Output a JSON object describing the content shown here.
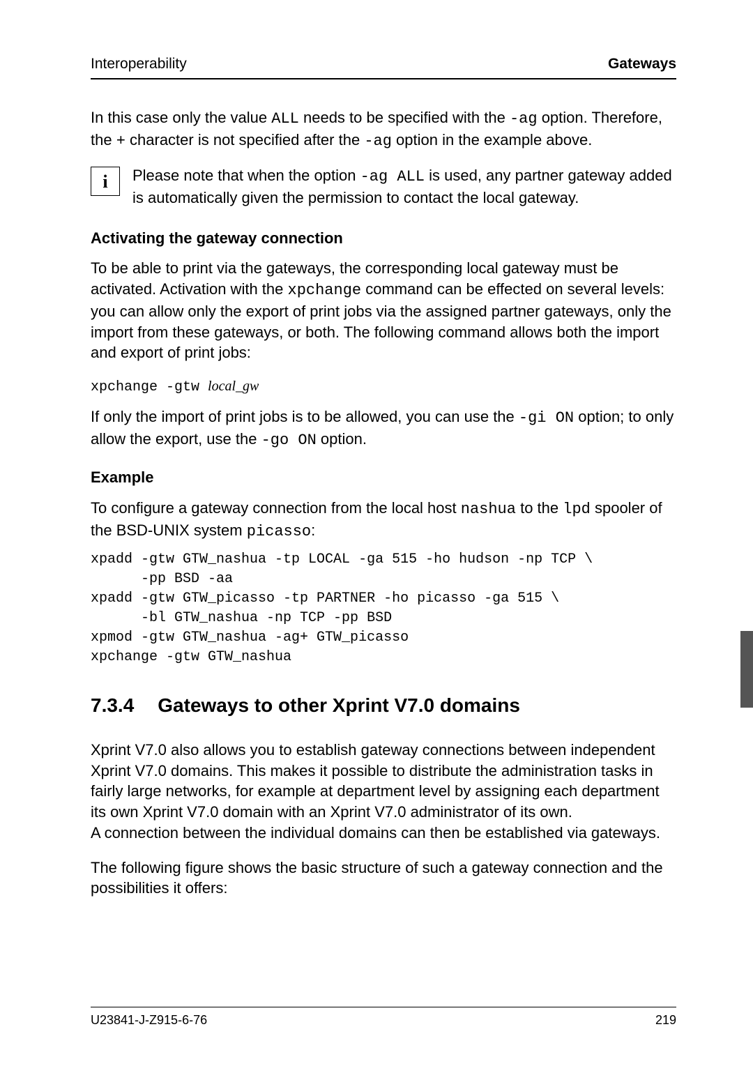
{
  "header": {
    "left": "Interoperability",
    "right": "Gateways"
  },
  "intro": {
    "p1a": "In this case only the value ",
    "p1code1": "ALL",
    "p1b": " needs to be specified with the ",
    "p1code2": "-ag",
    "p1c": " option. Therefore, the ",
    "p1plus": "+",
    "p1d": " character is not specified after the ",
    "p1code3": "-ag",
    "p1e": " option in the example above."
  },
  "info": {
    "icon": "i",
    "t1": "Please note that when the option ",
    "code": "-ag ALL",
    "t2": " is used, any partner gateway added is automatically given the permission to contact the local gateway."
  },
  "activating": {
    "heading": "Activating the gateway connection",
    "p1a": "To be able to print via the gateways, the corresponding local gateway must be activated. Activation with the ",
    "p1code": "xpchange",
    "p1b": " command can be effected on several levels: you can allow only the export of print jobs via the assigned partner gateways, only the import from these gateways, or both. The following command allows both the import and export of print jobs:",
    "cmd_prefix": "xpchange -gtw ",
    "cmd_arg": "local_gw",
    "p2a": "If only the import of print jobs is to be allowed, you can use the ",
    "p2code1": "-gi ON",
    "p2b": " option; to only allow the export, use the ",
    "p2code2": "-go ON",
    "p2c": " option."
  },
  "example": {
    "heading": "Example",
    "p1a": "To configure a gateway connection from the local host ",
    "p1code1": "nashua",
    "p1b": " to the ",
    "p1code2": "lpd",
    "p1c": " spooler of the BSD-UNIX system ",
    "p1code3": "picasso",
    "p1d": ":",
    "code": "xpadd -gtw GTW_nashua -tp LOCAL -ga 515 -ho hudson -np TCP \\\n      -pp BSD -aa\nxpadd -gtw GTW_picasso -tp PARTNER -ho picasso -ga 515 \\\n      -bl GTW_nashua -np TCP -pp BSD\nxpmod -gtw GTW_nashua -ag+ GTW_picasso\nxpchange -gtw GTW_nashua"
  },
  "section": {
    "num": "7.3.4",
    "title": "Gateways to other Xprint V7.0 domains",
    "p1": "Xprint V7.0 also allows you to establish gateway connections between independent Xprint V7.0 domains. This makes it possible to distribute the administration tasks in fairly large networks, for example at department level by assigning each department its own Xprint V7.0 domain with an Xprint V7.0 administrator of its own.",
    "p2": "A connection between the individual domains can then be established via gateways.",
    "p3": "The following figure shows the basic structure of such a gateway connection and the possibilities it offers:"
  },
  "footer": {
    "left": "U23841-J-Z915-6-76",
    "right": "219"
  }
}
